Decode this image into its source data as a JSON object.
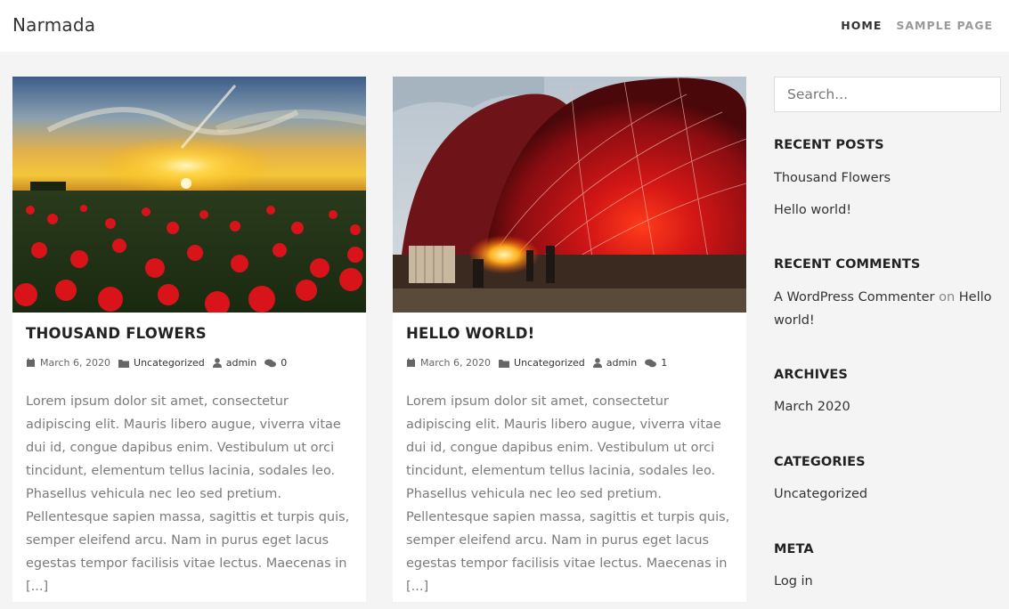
{
  "header": {
    "site_title": "Narmada",
    "nav": [
      {
        "label": "HOME",
        "active": true
      },
      {
        "label": "SAMPLE PAGE",
        "active": false
      }
    ]
  },
  "posts": [
    {
      "title": "THOUSAND FLOWERS",
      "date": "March 6, 2020",
      "category": "Uncategorized",
      "author": "admin",
      "comments": "0",
      "excerpt": "Lorem ipsum dolor sit amet, consectetur adipiscing elit. Mauris libero augue, viverra vitae dui id, congue dapibus enim. Vestibulum ut orci tincidunt, elementum tellus lacinia, sodales leo. Phasellus vehicula nec leo sed pretium. Pellentesque sapien massa, sagittis et turpis quis, semper eleifend arcu. Nam in purus eget lacus egestas tempor facilisis vitae lectus. Maecenas in [...]",
      "image": "poppy-field-sunset"
    },
    {
      "title": "HELLO WORLD!",
      "date": "March 6, 2020",
      "category": "Uncategorized",
      "author": "admin",
      "comments": "1",
      "excerpt": "Lorem ipsum dolor sit amet, consectetur adipiscing elit. Mauris libero augue, viverra vitae dui id, congue dapibus enim. Vestibulum ut orci tincidunt, elementum tellus lacinia, sodales leo. Phasellus vehicula nec leo sed pretium. Pellentesque sapien massa, sagittis et turpis quis, semper eleifend arcu. Nam in purus eget lacus egestas tempor facilisis vitae lectus. Maecenas in [...]",
      "image": "hot-air-balloon-inflating"
    }
  ],
  "sidebar": {
    "search_placeholder": "Search...",
    "recent_posts": {
      "title": "RECENT POSTS",
      "items": [
        "Thousand Flowers",
        "Hello world!"
      ]
    },
    "recent_comments": {
      "title": "RECENT COMMENTS",
      "author": "A WordPress Commenter",
      "on": "on",
      "post": "Hello world!"
    },
    "archives": {
      "title": "ARCHIVES",
      "items": [
        "March 2020"
      ]
    },
    "categories": {
      "title": "CATEGORIES",
      "items": [
        "Uncategorized"
      ]
    },
    "meta": {
      "title": "META",
      "items": [
        "Log in"
      ]
    }
  },
  "icons": [
    "calendar-icon",
    "folder-icon",
    "user-icon",
    "comments-icon"
  ],
  "colors": {
    "text": "#333333",
    "muted": "#7b7b7b",
    "background": "#f4f4f4",
    "card": "#ffffff"
  }
}
